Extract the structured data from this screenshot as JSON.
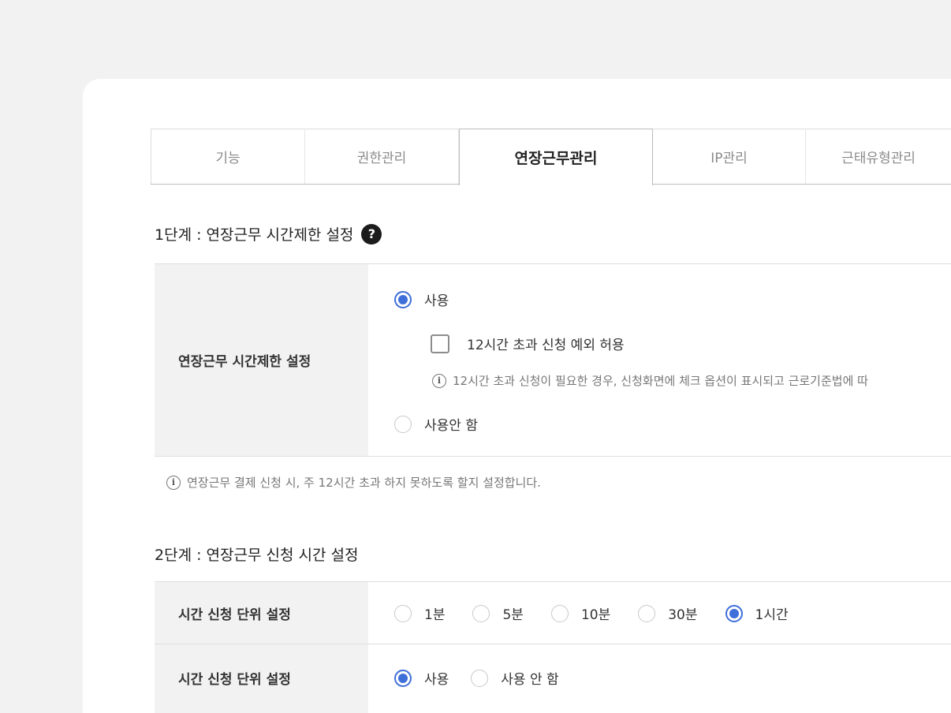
{
  "tabs": [
    {
      "label": "기능"
    },
    {
      "label": "권한관리"
    },
    {
      "label": "연장근무관리",
      "active": true
    },
    {
      "label": "IP관리"
    },
    {
      "label": "근태유형관리"
    }
  ],
  "section1": {
    "title": "1단계 : 연장근무 시간제한 설정",
    "help_icon": "question-circle-icon",
    "row_label": "연장근무 시간제한 설정",
    "option_use": "사용",
    "option_use_selected": true,
    "checkbox_label": "12시간 초과 신청 예외 허용",
    "checkbox_checked": false,
    "checkbox_note": "12시간 초과 신청이 필요한 경우, 신청화면에 체크 옵션이 표시되고 근로기준법에 따",
    "option_not_use": "사용안 함",
    "footer_note": "연장근무 결제 신청 시, 주 12시간 초과 하지  못하도록 할지 설정합니다."
  },
  "section2": {
    "title": "2단계 : 연장근무 신청 시간 설정",
    "rows": [
      {
        "label": "시간 신청 단위 설정",
        "options": [
          {
            "label": "1분",
            "selected": false
          },
          {
            "label": "5분",
            "selected": false
          },
          {
            "label": "10분",
            "selected": false
          },
          {
            "label": "30분",
            "selected": false
          },
          {
            "label": "1시간",
            "selected": true
          }
        ]
      },
      {
        "label": "시간 신청 단위 설정",
        "options": [
          {
            "label": "사용",
            "selected": true
          },
          {
            "label": "사용 안 함",
            "selected": false
          }
        ]
      }
    ]
  },
  "colors": {
    "accent": "#3f6fd8",
    "header_bg": "#f2f2f2",
    "border": "#dedede"
  }
}
